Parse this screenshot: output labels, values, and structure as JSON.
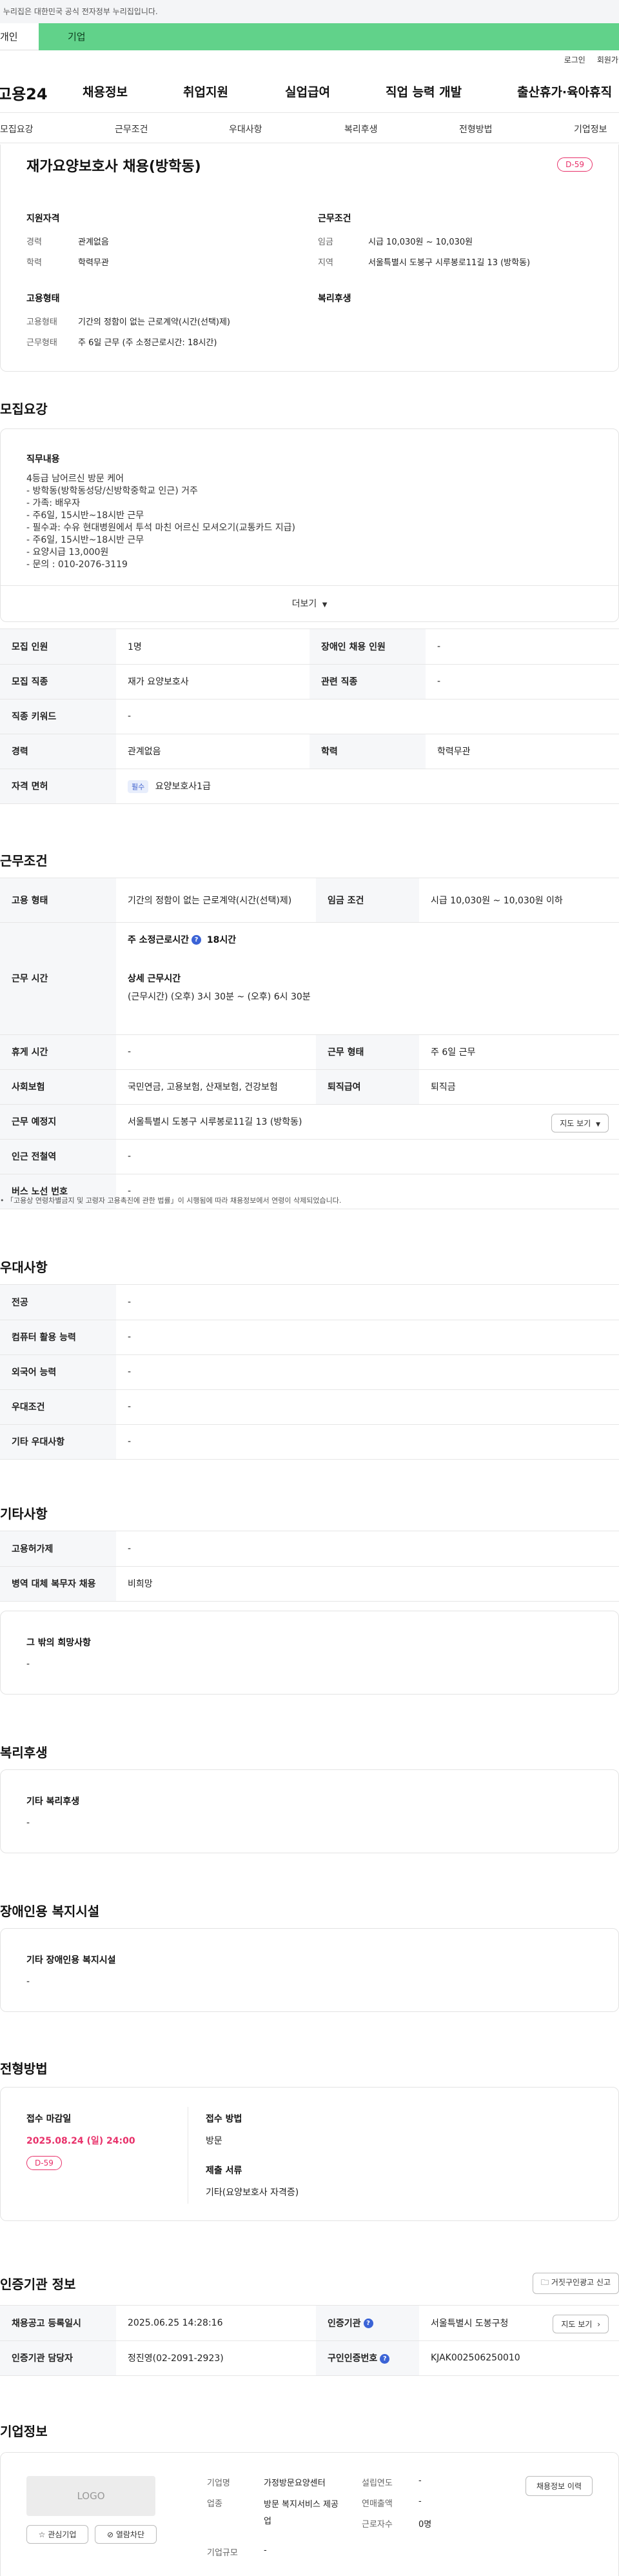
{
  "top": {
    "notice": "이 누리집은 대한민국 공식 전자정부 누리집입니다.",
    "tab_person": "개인",
    "tab_company": "기업",
    "login": "로그인",
    "signup": "회원가입"
  },
  "gnb": {
    "logo": "고용24",
    "menu": [
      "채용정보",
      "취업지원",
      "실업급여",
      "직업 능력 개발",
      "출산휴가·육아휴직"
    ]
  },
  "anchors": [
    "모집요강",
    "근무조건",
    "우대사항",
    "복리후생",
    "전형방법",
    "기업정보"
  ],
  "summary": {
    "title": "재가요양보호사 채용(방학동)",
    "dday": "D-59",
    "qual_title": "지원자격",
    "qual_career_label": "경력",
    "qual_career": "관계없음",
    "qual_edu_label": "학력",
    "qual_edu": "학력무관",
    "cond_title": "근무조건",
    "cond_wage_label": "임금",
    "cond_wage": "시급 10,030원 ~ 10,030원",
    "cond_region_label": "지역",
    "cond_region": "서울특별시 도봉구 시루봉로11길 13 (방학동)",
    "emp_title": "고용형태",
    "emp_type_label": "고용형태",
    "emp_type": "기간의 정함이 없는 근로계약(시간(선택)제)",
    "emp_work_label": "근무형태",
    "emp_work": "주 6일 근무 (주 소정근로시간: 18시간)",
    "welfare_title": "복리후생"
  },
  "recruit": {
    "title": "모집요강",
    "duty_title": "직무내용",
    "duty_lines": [
      "4등급 남어르신 방문 케어",
      "- 방학동(방학동성당/신방학중학교 인근) 거주",
      "- 가족: 배우자",
      "- 주6일, 15시반~18시반 근무",
      "- 필수과: 수유 현대병원에서 투석 마친 어르신 모셔오기(교통카드 지급)",
      "- 주6일, 15시반~18시반 근무",
      "- 요양시급 13,000원",
      "- 문의 : 010-2076-3119"
    ],
    "more": "더보기",
    "rows": [
      [
        "모집 인원",
        "1명",
        "장애인 채용 인원",
        "-"
      ],
      [
        "모집 직종",
        "재가 요양보호사",
        "관련 직종",
        "-"
      ],
      [
        "직종 키워드",
        "-"
      ],
      [
        "경력",
        "관계없음",
        "학력",
        "학력무관"
      ]
    ],
    "license_label": "자격 면허",
    "license_tag": "필수",
    "license_value": "요양보호사1급"
  },
  "work": {
    "title": "근무조건",
    "emp_type_label": "고용 형태",
    "emp_type": "기간의 정함이 없는 근로계약(시간(선택)제)",
    "wage_label": "임금 조건",
    "wage": "시급 10,030원 ~ 10,030원 이하",
    "hours_label": "근무 시간",
    "hours_weekly_label": "주 소정근로시간",
    "hours_weekly": "18시간",
    "hours_detail_label": "상세 근무시간",
    "hours_detail": "(근무시간) (오후) 3시 30분 ~ (오후) 6시 30분",
    "holiday_label": "휴게 시간",
    "holiday": "-",
    "worktype_label": "근무 형태",
    "worktype": "주 6일 근무",
    "insurance_label": "사회보험",
    "insurance": "국민연금, 고용보험, 산재보험, 건강보험",
    "retire_label": "퇴직급여",
    "retire": "퇴직금",
    "place_label": "근무 예정지",
    "place": "서울특별시 도봉구 시루봉로11길 13 (방학동)",
    "map_btn": "지도 보기",
    "subway_label": "인근 전철역",
    "subway": "-",
    "bus_label": "버스 노선 번호",
    "bus": "-",
    "footnote": "「고용상 연령차별금지 및 고령자 고용촉진에 관한 법률」이 시행됨에 따라 채용정보에서 연령이 삭제되었습니다."
  },
  "pref": {
    "title": "우대사항",
    "rows": [
      [
        "전공",
        "-"
      ],
      [
        "컴퓨터 활용 능력",
        "-"
      ],
      [
        "외국어 능력",
        "-"
      ],
      [
        "우대조건",
        "-"
      ],
      [
        "기타 우대사항",
        "-"
      ]
    ]
  },
  "etc": {
    "title": "기타사항",
    "rows": [
      [
        "고용허가제",
        "-"
      ],
      [
        "병역 대체 복무자 채용",
        "비희망"
      ]
    ],
    "hope_title": "그 밖의 희망사항",
    "hope": "-"
  },
  "welfare": {
    "title": "복리후생",
    "box_title": "기타 복리후생",
    "box": "-"
  },
  "disabled": {
    "title": "장애인용 복지시설",
    "box_title": "기타 장애인용 복지시설",
    "box": "-"
  },
  "selection": {
    "title": "전형방법",
    "deadline_label": "접수 마감일",
    "deadline": "2025.08.24 (일) 24:00",
    "dday": "D-59",
    "method_label": "접수 방법",
    "method": "방문",
    "docs_label": "제출 서류",
    "docs": "기타(요양보호사 자격증)"
  },
  "agency": {
    "title": "인증기관 정보",
    "report_btn": "거짓구인광고 신고",
    "reg_label": "채용공고 등록일시",
    "reg": "2025.06.25 14:28:16",
    "org_label": "인증기관",
    "org": "서울특별시 도봉구청",
    "map_btn": "지도 보기",
    "staff_label": "인증기관 담당자",
    "staff": "정진영(02-2091-2923)",
    "id_label": "구인인증번호",
    "id": "KJAK002506250010"
  },
  "company": {
    "title": "기업정보",
    "logo": "LOGO",
    "fav_btn": "관심기업",
    "block_btn": "열람차단",
    "name_label": "기업명",
    "name": "가정방문요양센터",
    "industry_label": "업종",
    "industry": "방문 복지서비스 제공업",
    "size_label": "기업규모",
    "size": "-",
    "founded_label": "설립연도",
    "founded": "-",
    "sales_label": "연매출액",
    "sales": "-",
    "employees_label": "근로자수",
    "employees": "0명",
    "history_btn": "채용정보 이력"
  }
}
